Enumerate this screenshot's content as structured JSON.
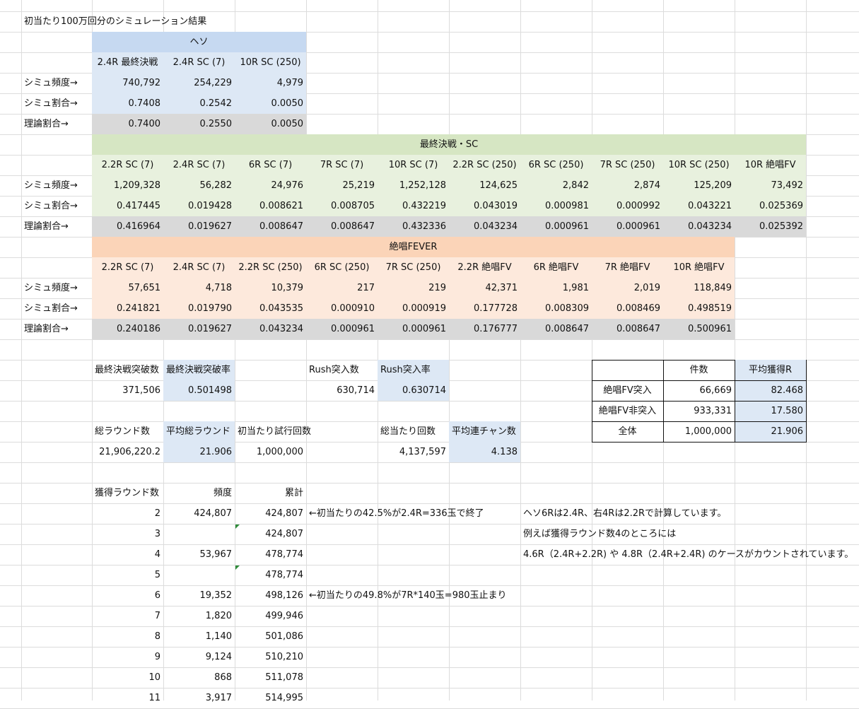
{
  "title": "初当たり100万回分のシミュレーション結果",
  "row_labels": {
    "freq": "シミュ頻度→",
    "ratio": "シミュ割合→",
    "theory": "理論割合→"
  },
  "heso": {
    "title": "ヘソ",
    "headers": [
      "2.4R 最終決戦",
      "2.4R SC (7)",
      "10R SC (250)"
    ],
    "freq": [
      "740,792",
      "254,229",
      "4,979"
    ],
    "ratio": [
      "0.7408",
      "0.2542",
      "0.0050"
    ],
    "theory": [
      "0.7400",
      "0.2550",
      "0.0050"
    ]
  },
  "final": {
    "title": "最終決戦・SC",
    "headers": [
      "2.2R SC (7)",
      "2.4R SC (7)",
      "6R SC (7)",
      "7R SC (7)",
      "10R SC (7)",
      "2.2R SC (250)",
      "6R SC (250)",
      "7R SC (250)",
      "10R SC (250)",
      "10R 絶唱FV"
    ],
    "freq": [
      "1,209,328",
      "56,282",
      "24,976",
      "25,219",
      "1,252,128",
      "124,625",
      "2,842",
      "2,874",
      "125,209",
      "73,492"
    ],
    "ratio": [
      "0.417445",
      "0.019428",
      "0.008621",
      "0.008705",
      "0.432219",
      "0.043019",
      "0.000981",
      "0.000992",
      "0.043221",
      "0.025369"
    ],
    "theory": [
      "0.416964",
      "0.019627",
      "0.008647",
      "0.008647",
      "0.432336",
      "0.043234",
      "0.000961",
      "0.000961",
      "0.043234",
      "0.025392"
    ]
  },
  "fever": {
    "title": "絶唱FEVER",
    "headers": [
      "2.2R SC (7)",
      "2.4R SC (7)",
      "2.2R SC (250)",
      "6R SC (250)",
      "7R SC (250)",
      "2.2R 絶唱FV",
      "6R 絶唱FV",
      "7R 絶唱FV",
      "10R 絶唱FV"
    ],
    "freq": [
      "57,651",
      "4,718",
      "10,379",
      "217",
      "219",
      "42,371",
      "1,981",
      "2,019",
      "118,849"
    ],
    "ratio": [
      "0.241821",
      "0.019790",
      "0.043535",
      "0.000910",
      "0.000919",
      "0.177728",
      "0.008309",
      "0.008469",
      "0.498519"
    ],
    "theory": [
      "0.240186",
      "0.019627",
      "0.043234",
      "0.000961",
      "0.000961",
      "0.176777",
      "0.008647",
      "0.008647",
      "0.500961"
    ]
  },
  "summary": {
    "breakthrough_label": "最終決戦突破数",
    "breakthrough_value": "371,506",
    "breakthrough_rate_label": "最終決戦突破率",
    "breakthrough_rate_value": "0.501498",
    "rush_label": "Rush突入数",
    "rush_value": "630,714",
    "rush_rate_label": "Rush突入率",
    "rush_rate_value": "0.630714",
    "total_rounds_label": "総ラウンド数",
    "total_rounds_value": "21,906,220.2",
    "avg_rounds_label": "平均総ラウンド",
    "avg_rounds_value": "21.906",
    "trials_label": "初当たり試行回数",
    "trials_value": "1,000,000",
    "total_hits_label": "総当たり回数",
    "total_hits_value": "4,137,597",
    "avg_chain_label": "平均連チャン数",
    "avg_chain_value": "4.138"
  },
  "fv_table": {
    "headers": [
      "",
      "件数",
      "平均獲得R"
    ],
    "rows": [
      [
        "絶唱FV突入",
        "66,669",
        "82.468"
      ],
      [
        "絶唱FV非突入",
        "933,331",
        "17.580"
      ],
      [
        "全体",
        "1,000,000",
        "21.906"
      ]
    ]
  },
  "dist": {
    "headers": [
      "獲得ラウンド数",
      "頻度",
      "累計"
    ],
    "rows": [
      [
        "2",
        "424,807",
        "424,807"
      ],
      [
        "3",
        "",
        "424,807"
      ],
      [
        "4",
        "53,967",
        "478,774"
      ],
      [
        "5",
        "",
        "478,774"
      ],
      [
        "6",
        "19,352",
        "498,126"
      ],
      [
        "7",
        "1,820",
        "499,946"
      ],
      [
        "8",
        "1,140",
        "501,086"
      ],
      [
        "9",
        "9,124",
        "510,210"
      ],
      [
        "10",
        "868",
        "511,078"
      ],
      [
        "11",
        "3,917",
        "514,995"
      ]
    ],
    "note1": "←初当たりの42.5%が2.4R=336玉で終了",
    "note2": "←初当たりの49.8%が7R*140玉=980玉止まり"
  },
  "notes": [
    "ヘソ6Rは2.4R、右4Rは2.2Rで計算しています。",
    "例えば獲得ラウンド数4のところには",
    "4.6R（2.4R+2.2R) や 4.8R（2.4R+2.4R) のケースがカウントされています。"
  ]
}
